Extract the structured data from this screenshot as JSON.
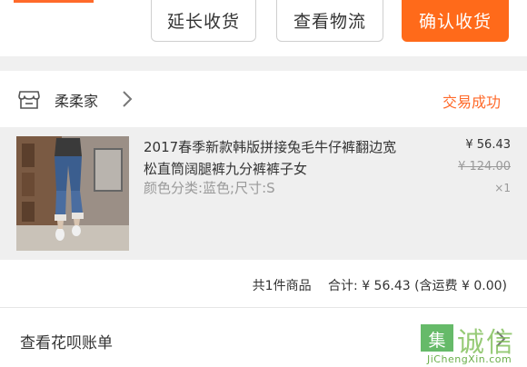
{
  "actions": {
    "extend_receipt": "延长收货",
    "view_logistics": "查看物流",
    "confirm_receipt": "确认收货"
  },
  "shop": {
    "name": "柔柔家",
    "status": "交易成功",
    "icon": "store-icon"
  },
  "item": {
    "title": "2017春季新款韩版拼接兔毛牛仔裤翻边宽松直筒阔腿裤九分裤裤子女",
    "sku": "颜色分类:蓝色;尺寸:S",
    "price": "¥ 56.43",
    "original_price": "¥ 124.00",
    "quantity": "×1"
  },
  "summary": {
    "count_text": "共1件商品",
    "total_text": "合计: ¥ 56.43 (含运费 ¥ 0.00)"
  },
  "bill": {
    "label": "查看花呗账单",
    "icon": "chevron-right-icon"
  },
  "watermark": {
    "glyph": "集",
    "text": "诚信",
    "sub": "JiChengXin.com"
  },
  "colors": {
    "accent": "#ff6a1a",
    "status": "#ff6a2a"
  }
}
